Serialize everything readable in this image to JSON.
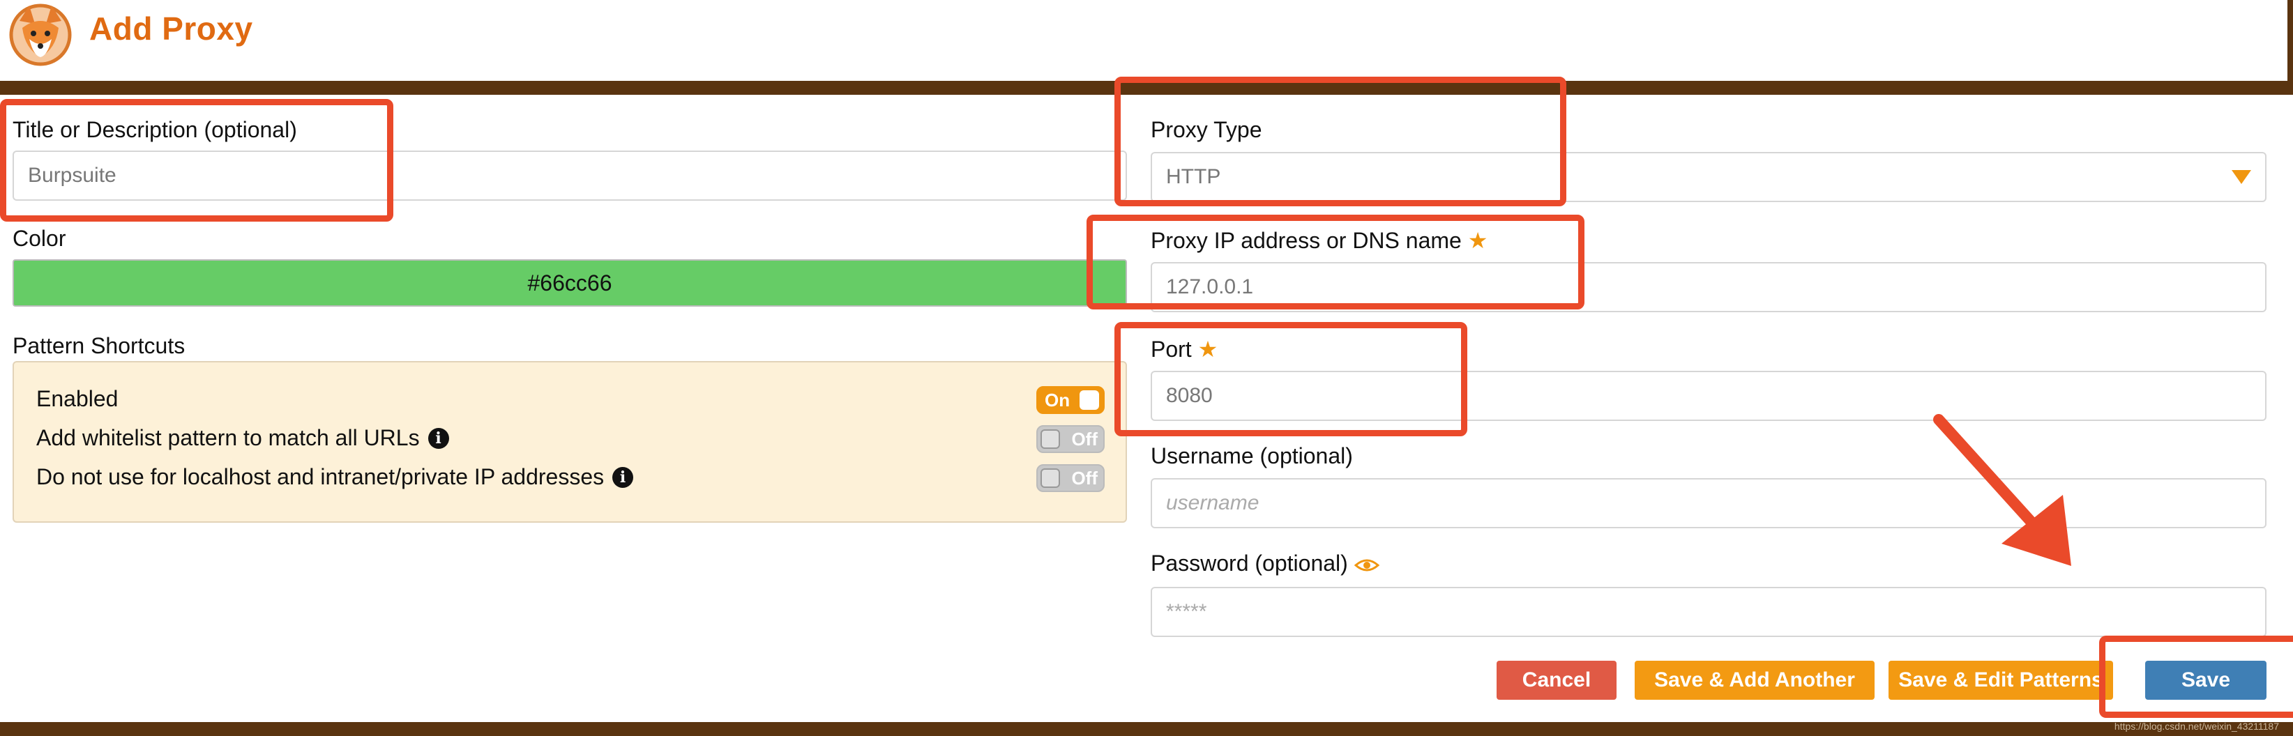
{
  "app": {
    "title": "Add Proxy",
    "logo_icon": "firefox-fox-logo-icon"
  },
  "colors": {
    "brand": "#e06a12",
    "frame": "#5a3410",
    "color_swatch": "#66cc66",
    "cancel": "#e05a45",
    "secondary": "#f39a12",
    "save": "#3f7fb5",
    "annotation": "#ea4a2a"
  },
  "form": {
    "title": {
      "label": "Title or Description (optional)",
      "value": "Burpsuite"
    },
    "color": {
      "label": "Color",
      "value": "#66cc66"
    },
    "pattern_shortcuts": {
      "label": "Pattern Shortcuts",
      "items": [
        {
          "label": "Enabled",
          "state": "On",
          "info": false
        },
        {
          "label": "Add whitelist pattern to match all URLs",
          "state": "Off",
          "info": true
        },
        {
          "label": "Do not use for localhost and intranet/private IP addresses",
          "state": "Off",
          "info": true
        }
      ]
    },
    "proxy_type": {
      "label": "Proxy Type",
      "value": "HTTP"
    },
    "proxy_host": {
      "label": "Proxy IP address or DNS name",
      "value": "127.0.0.1",
      "required_icon": "star-icon"
    },
    "port": {
      "label": "Port",
      "value": "8080",
      "required_icon": "star-icon"
    },
    "username": {
      "label": "Username (optional)",
      "placeholder": "username"
    },
    "password": {
      "label": "Password (optional)",
      "placeholder": "*****",
      "toggle_icon": "eye-icon"
    }
  },
  "buttons": {
    "cancel": "Cancel",
    "save_add_another": "Save & Add Another",
    "save_edit_patterns": "Save & Edit Patterns",
    "save": "Save"
  },
  "footer": {
    "watermark": "https://blog.csdn.net/weixin_43211187"
  }
}
